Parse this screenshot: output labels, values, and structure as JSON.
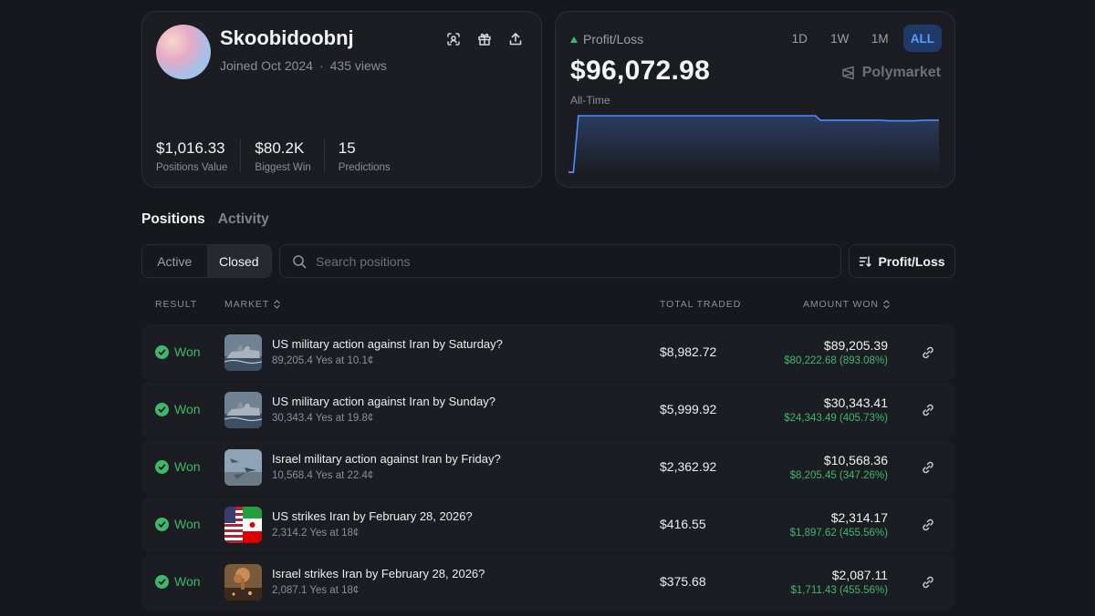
{
  "profile": {
    "username": "Skoobidoobnj",
    "joined": "Joined Oct 2024",
    "separator": "·",
    "views": "435 views",
    "actions": [
      "scan-icon",
      "gift-icon",
      "share-icon"
    ],
    "stats": [
      {
        "value": "$1,016.33",
        "label": "Positions Value"
      },
      {
        "value": "$80.2K",
        "label": "Biggest Win"
      },
      {
        "value": "15",
        "label": "Predictions"
      }
    ]
  },
  "pnl": {
    "label": "Profit/Loss",
    "value": "$96,072.98",
    "period": "All-Time",
    "brand": "Polymarket",
    "ranges": [
      "1D",
      "1W",
      "1M",
      "ALL"
    ],
    "active_range": "ALL",
    "accent": "#4f8cff",
    "chart_data": {
      "type": "area",
      "x": [
        0,
        1,
        2,
        3,
        50,
        51,
        60,
        63,
        65,
        70,
        72,
        75
      ],
      "y": [
        0,
        0,
        100,
        100,
        100,
        92,
        92,
        92,
        91,
        91,
        92,
        92
      ]
    }
  },
  "tabs": [
    "Positions",
    "Activity"
  ],
  "active_tab": "Positions",
  "filter": {
    "segments": [
      "Active",
      "Closed"
    ],
    "active_segment": "Closed",
    "search_placeholder": "Search positions",
    "sort_label": "Profit/Loss"
  },
  "table": {
    "headers": {
      "result": "RESULT",
      "market": "MARKET",
      "total_traded": "TOTAL TRADED",
      "amount_won": "AMOUNT WON"
    },
    "rows": [
      {
        "result": "Won",
        "title": "US military action against Iran by Saturday?",
        "sub": "89,205.4 Yes at 10.1¢",
        "traded": "$8,982.72",
        "won": "$89,205.39",
        "gain": "$80,222.68 (893.08%)",
        "thumb": "warship"
      },
      {
        "result": "Won",
        "title": "US military action against Iran by Sunday?",
        "sub": "30,343.4 Yes at 19.8¢",
        "traded": "$5,999.92",
        "won": "$30,343.41",
        "gain": "$24,343.49 (405.73%)",
        "thumb": "warship"
      },
      {
        "result": "Won",
        "title": "Israel military action against Iran by Friday?",
        "sub": "10,568.4 Yes at 22.4¢",
        "traded": "$2,362.92",
        "won": "$10,568.36",
        "gain": "$8,205.45 (347.26%)",
        "thumb": "jets"
      },
      {
        "result": "Won",
        "title": "US strikes Iran by February 28, 2026?",
        "sub": "2,314.2 Yes at 18¢",
        "traded": "$416.55",
        "won": "$2,314.17",
        "gain": "$1,897.62 (455.56%)",
        "thumb": "flags"
      },
      {
        "result": "Won",
        "title": "Israel strikes Iran by February 28, 2026?",
        "sub": "2,087.1 Yes at 18¢",
        "traded": "$375.68",
        "won": "$2,087.11",
        "gain": "$1,711.43 (455.56%)",
        "thumb": "explosion"
      }
    ]
  }
}
